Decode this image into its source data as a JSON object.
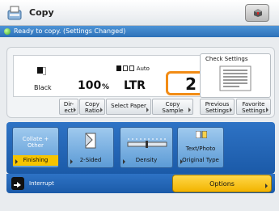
{
  "header": {
    "title": "Copy",
    "title_icon": "copy-icon",
    "status_monitor_icon": "status-monitor-icon"
  },
  "status": {
    "text": "Ready to copy. (Settings Changed)",
    "indicator_color": "#3aa828"
  },
  "current_settings": {
    "color_mode": "Black",
    "copy_ratio": "100",
    "copy_ratio_unit": "%",
    "paper_source": "Auto",
    "paper_size": "LTR",
    "copies": "2"
  },
  "check_settings": {
    "label": "Check Settings"
  },
  "setting_buttons": {
    "direct": [
      "Dir-",
      "ect"
    ],
    "copy_ratio": [
      "Copy",
      "Ratio"
    ],
    "select_paper": "Select Paper",
    "copy_sample": [
      "Copy",
      "Sample"
    ],
    "previous_settings": [
      "Previous",
      "Settings"
    ],
    "favorite_settings": [
      "Favorite",
      "Settings"
    ]
  },
  "functions": {
    "finishing": {
      "top": [
        "Collate +",
        "Other"
      ],
      "label": "Finishing",
      "selected": true
    },
    "two_sided": {
      "label": "2-Sided"
    },
    "density": {
      "label": "Density"
    },
    "original_type": {
      "top": "Text/Photo",
      "label": "Original Type"
    }
  },
  "bottom": {
    "interrupt": "Interrupt",
    "options": "Options"
  },
  "colors": {
    "accent_blue": "#2e73c5",
    "highlight_yellow": "#f6c400",
    "copies_border": "#f28c16"
  }
}
